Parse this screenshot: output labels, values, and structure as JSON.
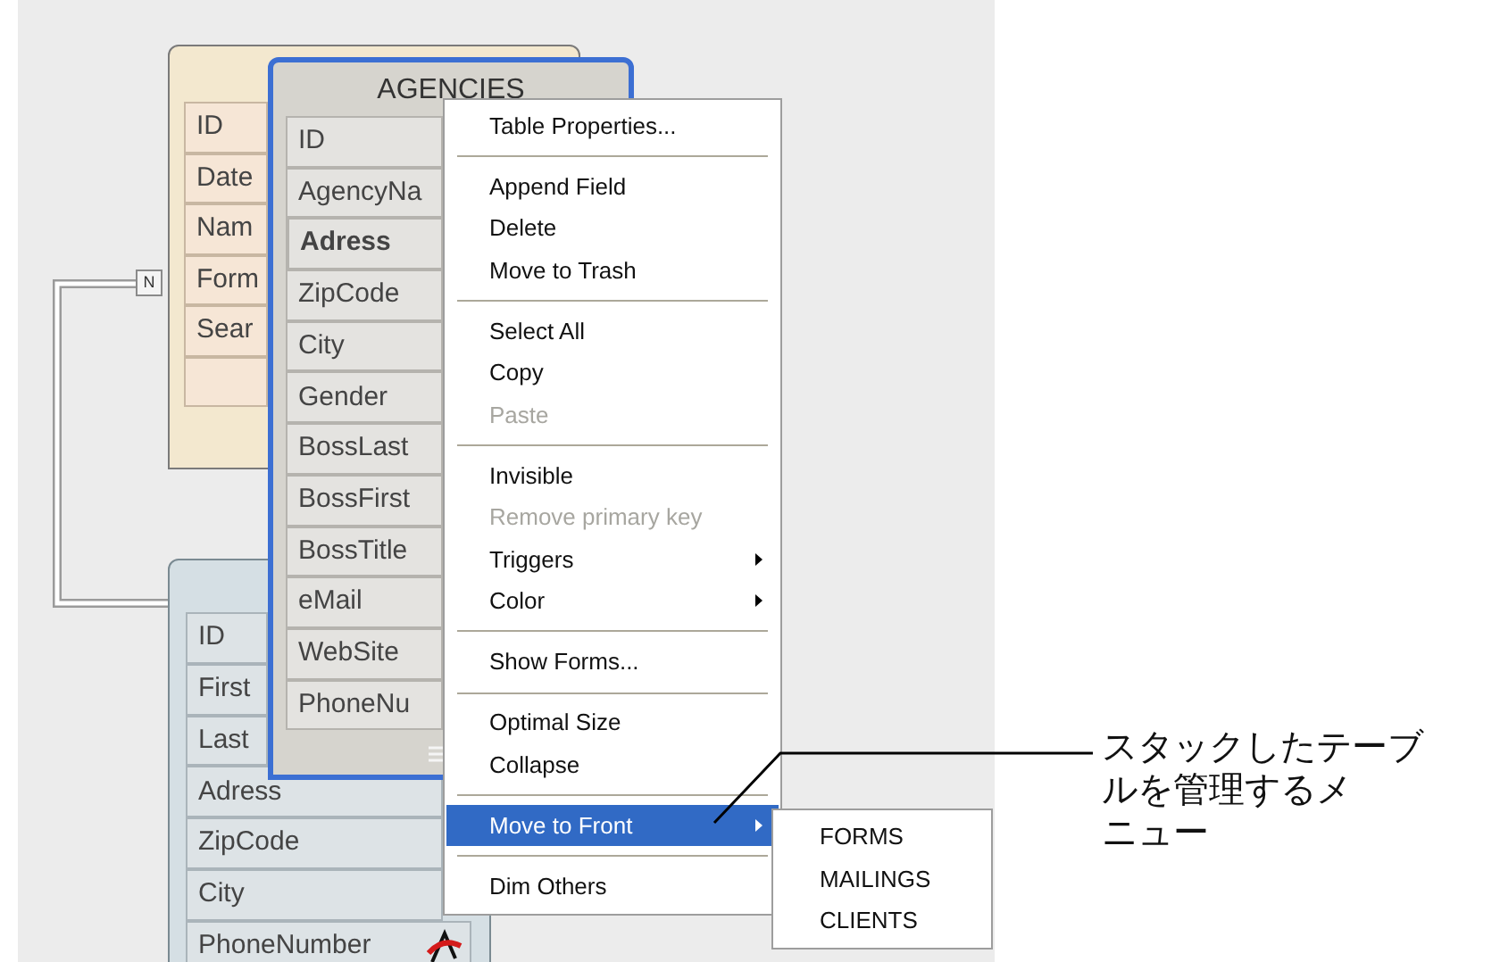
{
  "tables": [
    {
      "color": "#f3e8cf",
      "fields": [
        {
          "name": "ID",
          "bold": false
        },
        {
          "name": "Date",
          "bold": false
        },
        {
          "name": "Nam",
          "bold": false
        },
        {
          "name": "Form",
          "bold": false
        },
        {
          "name": "Sear",
          "bold": false
        },
        {
          "bold": false
        }
      ]
    },
    {
      "title": "AGENCIES",
      "color": "#d6d4ce",
      "fields": [
        {
          "name": "ID",
          "bold": false
        },
        {
          "name": "AgencyNa",
          "bold": false
        },
        {
          "name": "Adress",
          "bold": true
        },
        {
          "name": "ZipCode",
          "bold": false
        },
        {
          "name": "City",
          "bold": false
        },
        {
          "name": "Gender",
          "bold": false
        },
        {
          "name": "BossLast",
          "bold": false
        },
        {
          "name": "BossFirst",
          "bold": false
        },
        {
          "name": "BossTitle",
          "bold": false
        },
        {
          "name": "eMail",
          "bold": false
        },
        {
          "name": "WebSite",
          "bold": false
        },
        {
          "name": "PhoneNu",
          "bold": false
        }
      ]
    },
    {
      "color": "#d5dfe4",
      "fields": [
        {
          "name": "ID",
          "bold": false
        },
        {
          "name": "First",
          "bold": false
        },
        {
          "name": "Last",
          "bold": false
        },
        {
          "name": "Adress",
          "bold": false
        },
        {
          "name": "ZipCode",
          "bold": false
        },
        {
          "name": "City",
          "bold": false
        },
        {
          "name": "PhoneNumber",
          "bold": false
        }
      ]
    }
  ],
  "relation_badge": "N",
  "context_menu": [
    {
      "kind": "item",
      "label": "Table Properties...",
      "disabled": false,
      "submenu": false,
      "selected": false
    },
    {
      "kind": "separator"
    },
    {
      "kind": "item",
      "label": "Append Field",
      "disabled": false,
      "submenu": false,
      "selected": false
    },
    {
      "kind": "item",
      "label": "Delete",
      "disabled": false,
      "submenu": false,
      "selected": false
    },
    {
      "kind": "item",
      "label": "Move to Trash",
      "disabled": false,
      "submenu": false,
      "selected": false
    },
    {
      "kind": "separator"
    },
    {
      "kind": "item",
      "label": "Select All",
      "disabled": false,
      "submenu": false,
      "selected": false
    },
    {
      "kind": "item",
      "label": "Copy",
      "disabled": false,
      "submenu": false,
      "selected": false
    },
    {
      "kind": "item",
      "label": "Paste",
      "disabled": true,
      "submenu": false,
      "selected": false
    },
    {
      "kind": "separator"
    },
    {
      "kind": "item",
      "label": "Invisible",
      "disabled": false,
      "submenu": false,
      "selected": false
    },
    {
      "kind": "item",
      "label": "Remove primary key",
      "disabled": true,
      "submenu": false,
      "selected": false
    },
    {
      "kind": "item",
      "label": "Triggers",
      "disabled": false,
      "submenu": true,
      "selected": false
    },
    {
      "kind": "item",
      "label": "Color",
      "disabled": false,
      "submenu": true,
      "selected": false
    },
    {
      "kind": "separator"
    },
    {
      "kind": "item",
      "label": "Show Forms...",
      "disabled": false,
      "submenu": false,
      "selected": false
    },
    {
      "kind": "separator"
    },
    {
      "kind": "item",
      "label": "Optimal Size",
      "disabled": false,
      "submenu": false,
      "selected": false
    },
    {
      "kind": "item",
      "label": "Collapse",
      "disabled": false,
      "submenu": false,
      "selected": false
    },
    {
      "kind": "separator"
    },
    {
      "kind": "item",
      "label": "Move to Front",
      "disabled": false,
      "submenu": true,
      "selected": true
    },
    {
      "kind": "separator"
    },
    {
      "kind": "item",
      "label": "Dim Others",
      "disabled": false,
      "submenu": false,
      "selected": false
    }
  ],
  "submenu": [
    "FORMS",
    "MAILINGS",
    "CLIENTS"
  ],
  "annotation": "スタックしたテーブルを管理するメニュー"
}
